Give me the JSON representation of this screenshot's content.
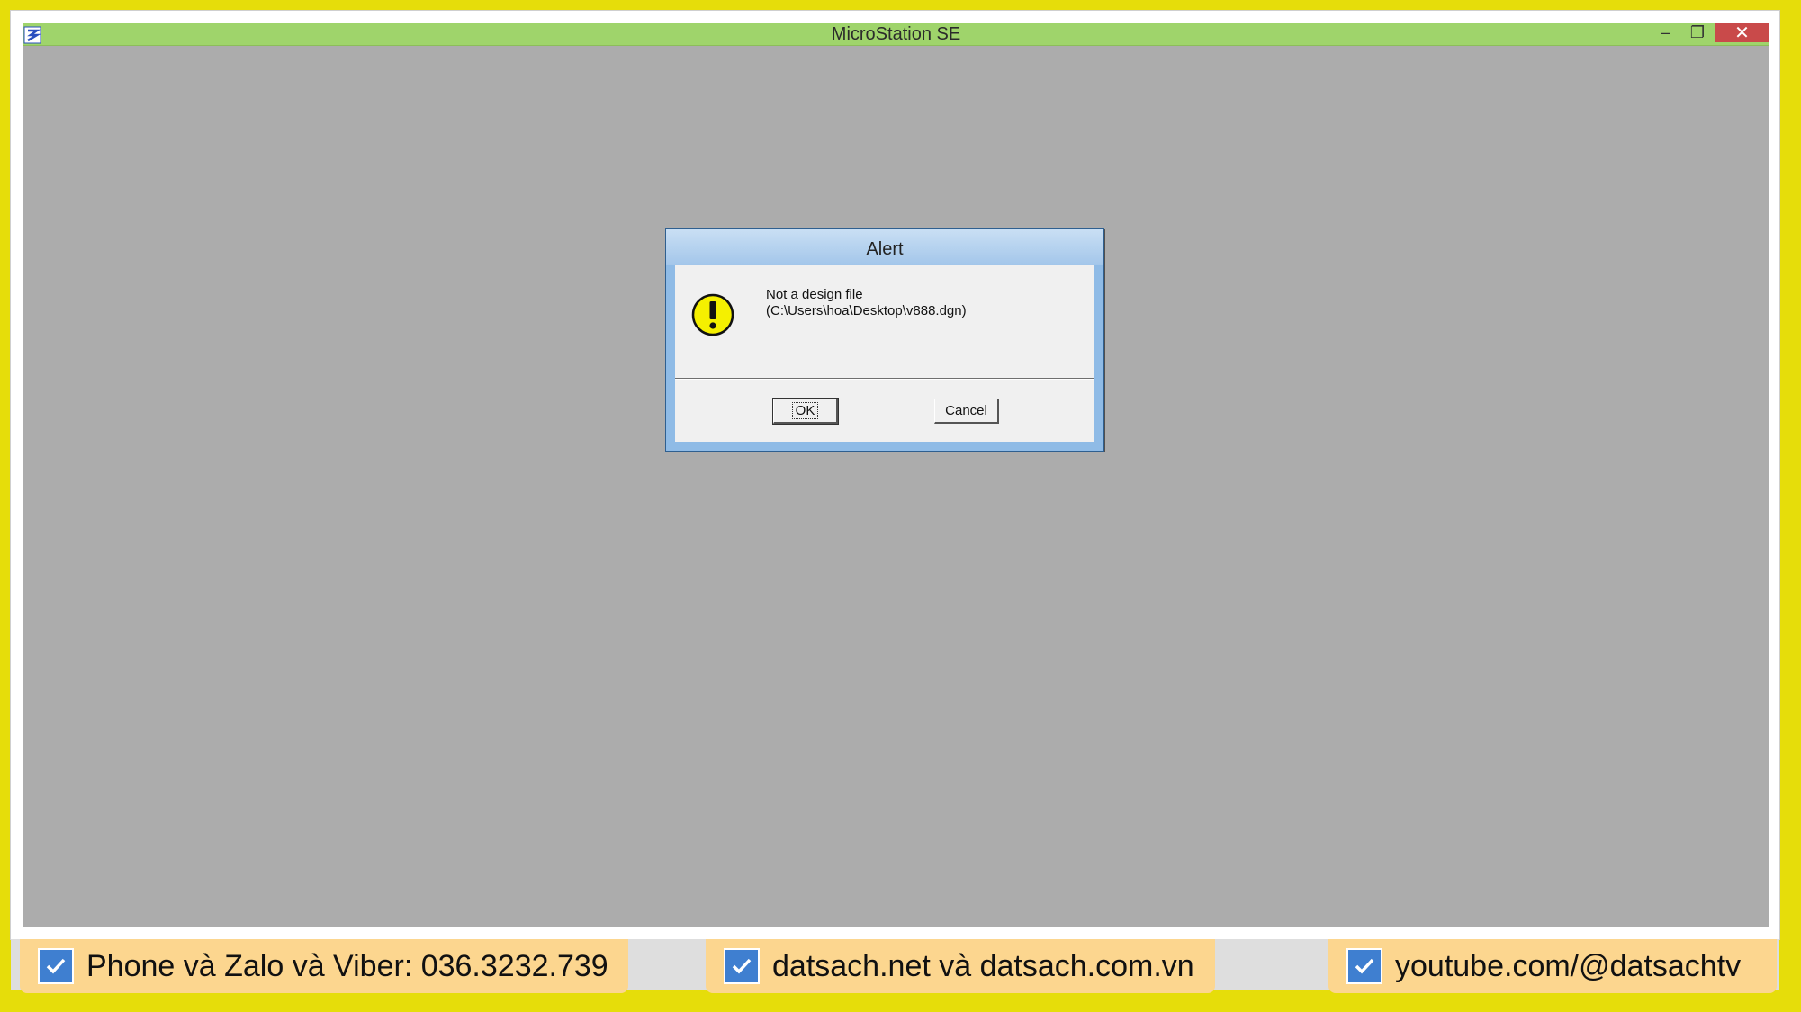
{
  "window": {
    "title": "MicroStation SE",
    "controls": {
      "minimize": "–",
      "maximize": "❐",
      "close": "✕"
    }
  },
  "dialog": {
    "title": "Alert",
    "message_line1": "Not a design file",
    "message_line2": "(C:\\Users\\hoa\\Desktop\\v888.dgn)",
    "icon": "warning-exclamation-icon",
    "ok_label": "OK",
    "cancel_label": "Cancel"
  },
  "promo": {
    "items": [
      {
        "label": "Phone và Zalo và Viber: 036.3232.739",
        "icon": "checkbox-icon"
      },
      {
        "label": "datsach.net và datsach.com.vn",
        "icon": "checkbox-icon"
      },
      {
        "label": "youtube.com/@datsachtv",
        "icon": "checkbox-icon"
      }
    ]
  },
  "colors": {
    "outer_border": "#e6dd0a",
    "titlebar": "#9fd46b",
    "workspace": "#acacac",
    "close_button": "#c94a4a",
    "dialog_frame": "#8fbbe6",
    "promo_tag": "#fcd68f",
    "check_blue": "#3f7fd0"
  }
}
